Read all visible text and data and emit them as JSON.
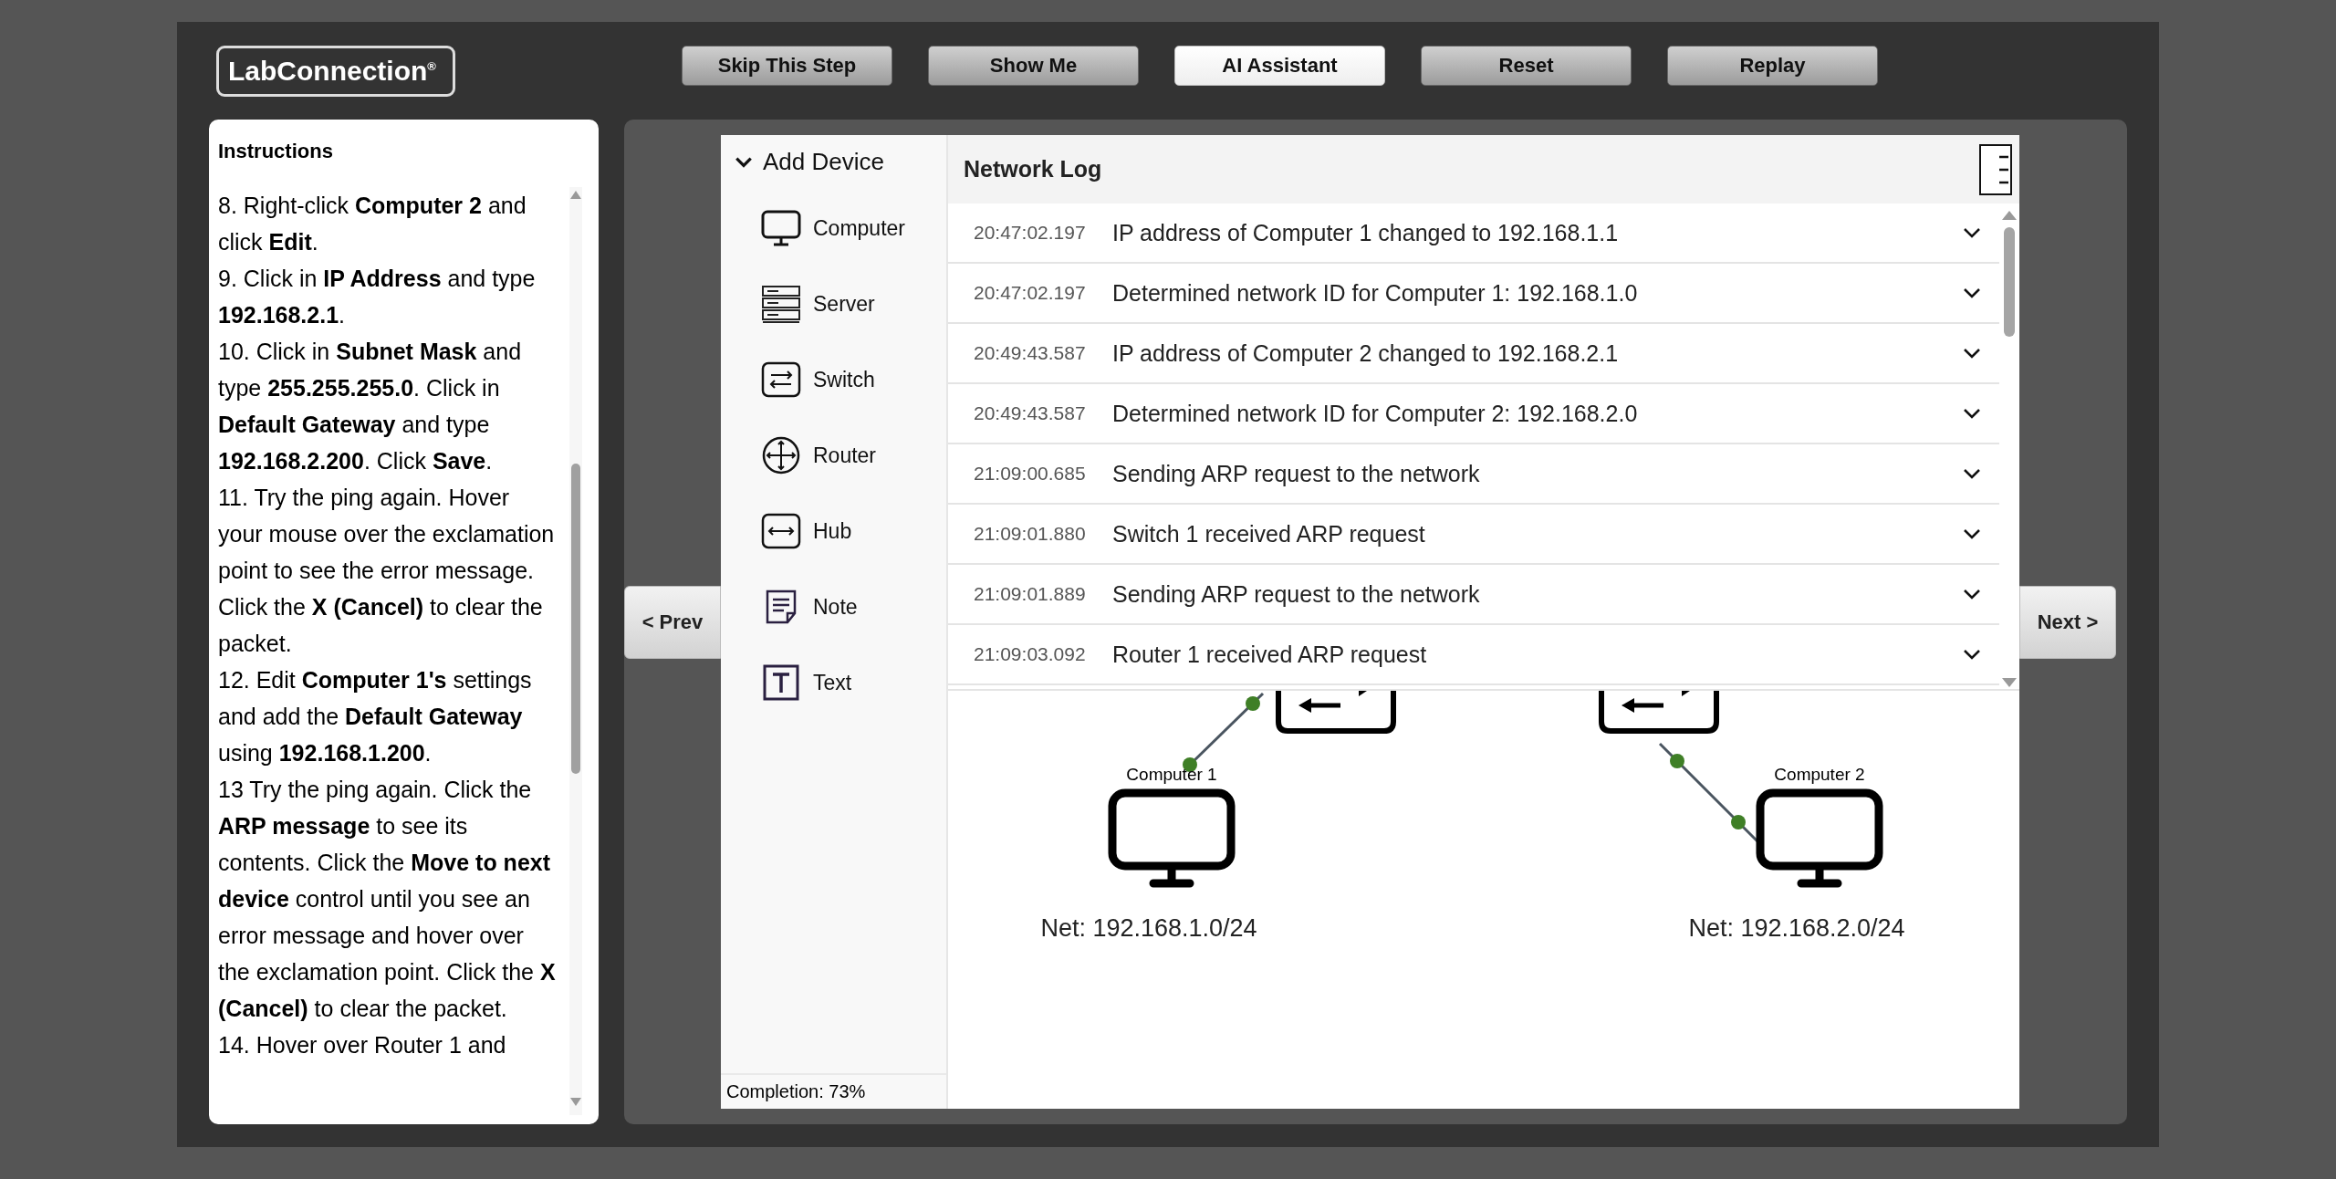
{
  "logo": "LabConnection$^{®}$",
  "toolbar": [
    {
      "label": "Skip This Step",
      "highlighted": false
    },
    {
      "label": "Show Me",
      "highlighted": false
    },
    {
      "label": "AI Assistant",
      "highlighted": true
    },
    {
      "label": "Reset",
      "highlighted": false
    },
    {
      "label": "Replay",
      "highlighted": false
    }
  ],
  "instructions": {
    "title": "Instructions",
    "steps": [
      "8. Right-click **Computer 2** and click **Edit**.",
      "9. Click in **IP Address** and type **192.168.2.1**.",
      "10. Click in **Subnet Mask** and type **255.255.255.0**. Click in **Default Gateway** and type **192.168.2.200**. Click **Save**.",
      "11. Try the ping again. Hover your mouse over the exclamation point to see the error message. Click the **X (Cancel)** to clear the packet.",
      "12. Edit **Computer 1's** settings and add the **Default Gateway** using **192.168.1.200**.",
      "13 Try the ping again. Click the **ARP message** to see its contents. Click the **Move to next device** control until you see an error message and hover over the exclamation point. Click the **X (Cancel)** to clear the packet.",
      "14. Hover over Router 1 and"
    ]
  },
  "navigation": {
    "prev": "< Prev",
    "next": "Next >"
  },
  "add_device": {
    "title": "Add Device",
    "expanded": true,
    "items": [
      {
        "kind": "computer",
        "label": "Computer"
      },
      {
        "kind": "server",
        "label": "Server"
      },
      {
        "kind": "switch",
        "label": "Switch"
      },
      {
        "kind": "router",
        "label": "Router"
      },
      {
        "kind": "hub",
        "label": "Hub"
      },
      {
        "kind": "note",
        "label": "Note"
      },
      {
        "kind": "text",
        "label": "Text"
      }
    ]
  },
  "completion": "Completion: 73%",
  "network_log": {
    "title": "Network Log",
    "entries": [
      {
        "time": "20:47:02.197",
        "message": "IP address of Computer 1 changed to 192.168.1.1"
      },
      {
        "time": "20:47:02.197",
        "message": "Determined network ID for Computer 1: 192.168.1.0"
      },
      {
        "time": "20:49:43.587",
        "message": "IP address of Computer 2 changed to 192.168.2.1"
      },
      {
        "time": "20:49:43.587",
        "message": "Determined network ID for Computer 2: 192.168.2.0"
      },
      {
        "time": "21:09:00.685",
        "message": "Sending ARP request to the network"
      },
      {
        "time": "21:09:01.880",
        "message": "Switch 1 received ARP request"
      },
      {
        "time": "21:09:01.889",
        "message": "Sending ARP request to the network"
      },
      {
        "time": "21:09:03.092",
        "message": "Router 1 received ARP request"
      }
    ]
  },
  "canvas": {
    "nodes": [
      {
        "kind": "switch"
      },
      {
        "kind": "computer",
        "label": "Computer 1",
        "network": "Net: 192.168.1.0/24"
      },
      {
        "kind": "switch"
      },
      {
        "kind": "computer",
        "label": "Computer 2",
        "network": "Net: 192.168.2.0/24"
      }
    ]
  }
}
